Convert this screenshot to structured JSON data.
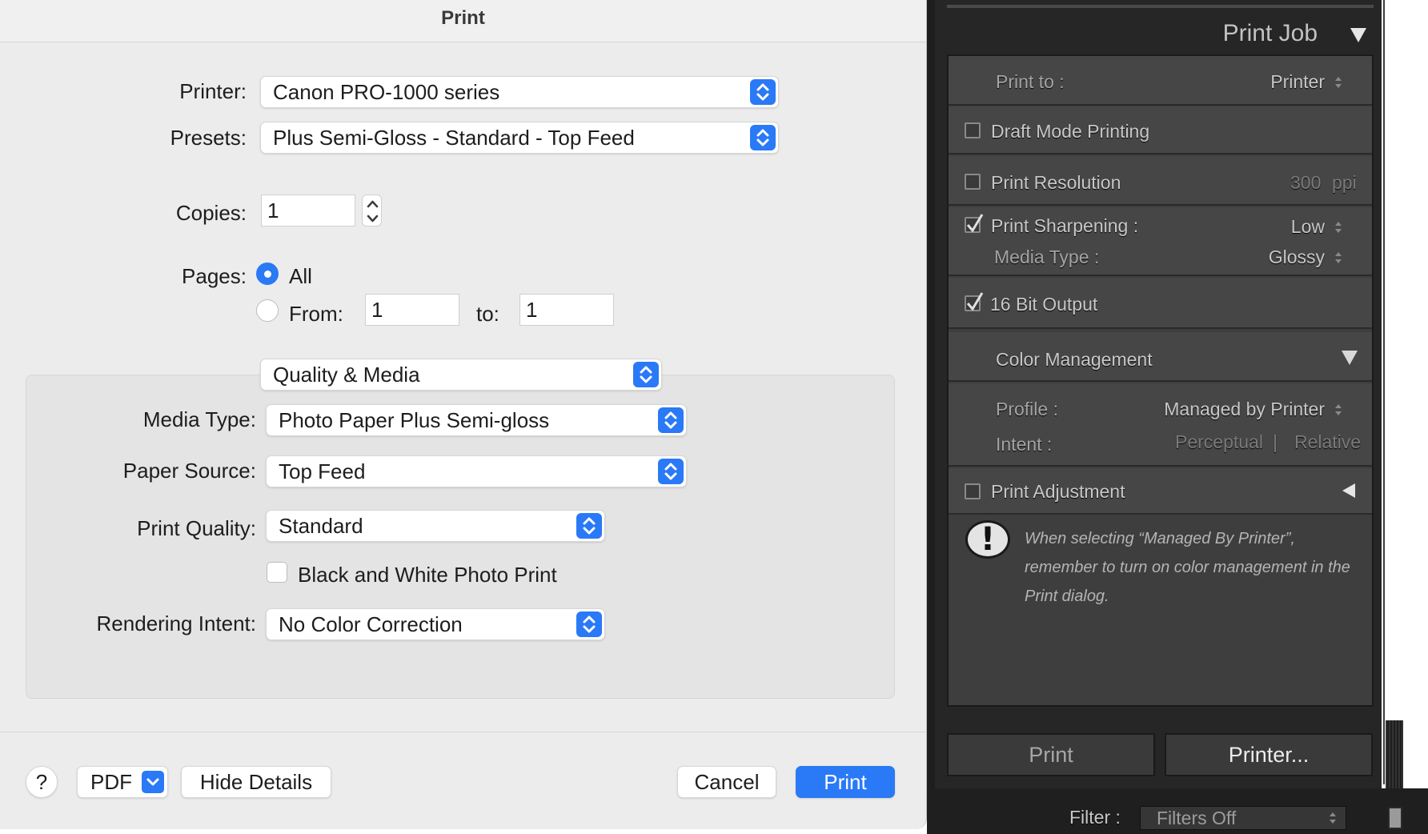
{
  "dialog": {
    "title": "Print",
    "printer": {
      "label": "Printer:",
      "value": "Canon PRO-1000 series"
    },
    "presets": {
      "label": "Presets:",
      "value": "Plus Semi-Gloss - Standard - Top Feed"
    },
    "copies": {
      "label": "Copies:",
      "value": "1"
    },
    "pages": {
      "label": "Pages:",
      "all_label": "All",
      "all_selected": true,
      "from_label": "From:",
      "from_value": "1",
      "to_label": "to:",
      "to_value": "1"
    },
    "section": "Quality & Media",
    "media_type": {
      "label": "Media Type:",
      "value": "Photo Paper Plus Semi-gloss"
    },
    "paper_source": {
      "label": "Paper Source:",
      "value": "Top Feed"
    },
    "print_quality": {
      "label": "Print Quality:",
      "value": "Standard"
    },
    "bw_photo_print": {
      "label": "Black and White Photo Print",
      "checked": false
    },
    "rendering_intent": {
      "label": "Rendering Intent:",
      "value": "No Color Correction"
    },
    "buttons": {
      "help": "?",
      "pdf": "PDF",
      "hide_details": "Hide Details",
      "cancel": "Cancel",
      "print": "Print"
    },
    "accent_color": "#2a79f7"
  },
  "lightroom": {
    "panel_title": "Print Job",
    "print_to": {
      "label": "Print to :",
      "value": "Printer"
    },
    "draft_mode": {
      "label": "Draft Mode Printing",
      "checked": false
    },
    "print_resolution": {
      "label": "Print Resolution",
      "value": "300",
      "unit": "ppi",
      "checked": false
    },
    "print_sharpening": {
      "label": "Print Sharpening :",
      "value": "Low",
      "checked": true
    },
    "media_type": {
      "label": "Media Type :",
      "value": "Glossy"
    },
    "bit_output": {
      "label": "16 Bit Output",
      "checked": true
    },
    "color_management": {
      "label": "Color Management",
      "profile_label": "Profile :",
      "profile_value": "Managed by Printer",
      "intent_label": "Intent :",
      "intent_options": [
        "Perceptual",
        "Relative"
      ],
      "separator": "|"
    },
    "print_adjustment": {
      "label": "Print Adjustment",
      "checked": false
    },
    "note": "When selecting “Managed By Printer”, remember to turn on color management in the Print dialog.",
    "buttons": {
      "print": "Print",
      "printer": "Printer..."
    },
    "filter": {
      "label": "Filter :",
      "value": "Filters Off"
    },
    "panel_bg": "#262626"
  }
}
